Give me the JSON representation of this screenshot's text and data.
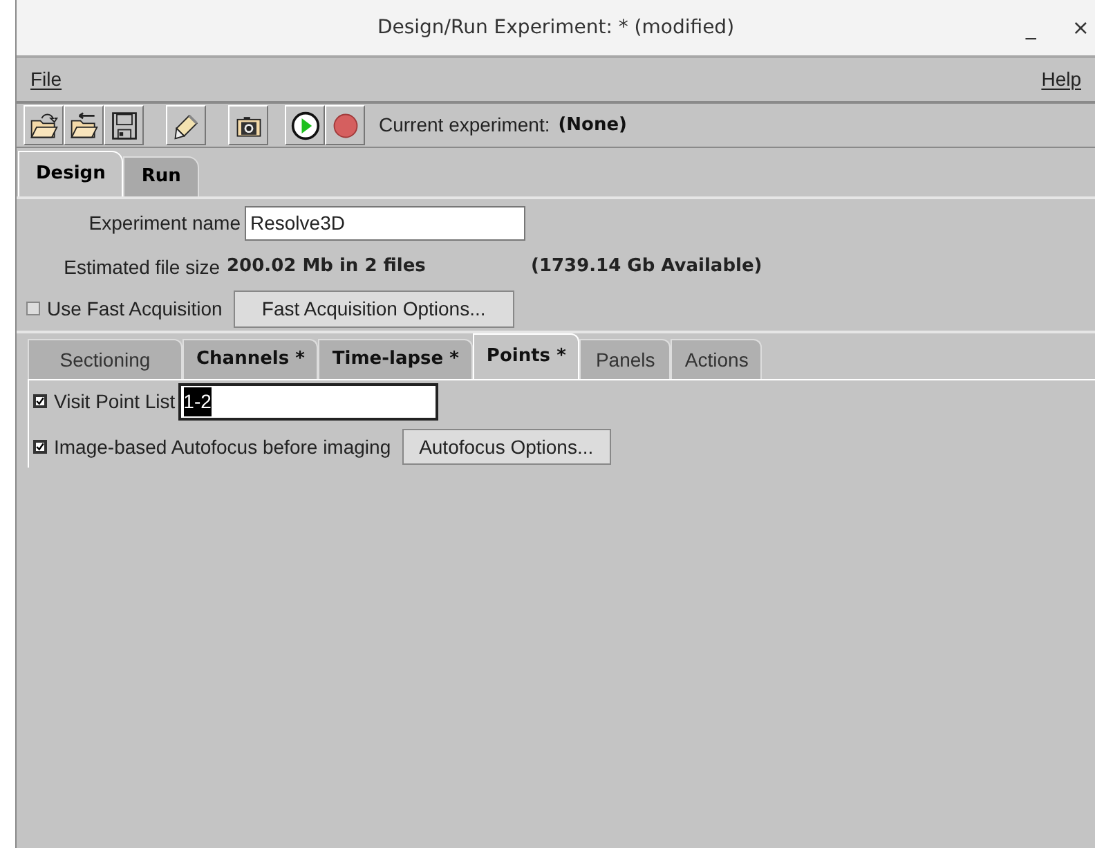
{
  "window": {
    "title": "Design/Run Experiment:  * (modified)",
    "controls": [
      "_",
      "×"
    ]
  },
  "menu": [
    {
      "label": "File"
    },
    {
      "label": "Help"
    }
  ],
  "toolbar": {
    "tools": [
      {
        "kind": "open"
      },
      {
        "kind": "revert"
      },
      {
        "kind": "save"
      },
      {
        "kind": "edit"
      },
      {
        "kind": "camera"
      },
      {
        "kind": "play"
      },
      {
        "kind": "record"
      }
    ],
    "label": "Current experiment:",
    "value": "(None)"
  },
  "tabs": [
    {
      "label": "Design",
      "selected": true
    },
    {
      "label": "Run",
      "selected": false
    }
  ],
  "experiment_name": {
    "label": "Experiment name",
    "value": "Resolve3D"
  },
  "file_size": {
    "label": "Estimated file size",
    "value": "200.02 Mb in 2 files",
    "available": "(1739.14 Gb Available)"
  },
  "fast_acquisition": {
    "label": "Use Fast Acquisition",
    "checked": false,
    "button": "Fast Acquisition Options..."
  },
  "sub_tabs": [
    {
      "label": "Sectioning",
      "modified": false,
      "selected": false
    },
    {
      "label": "Channels *",
      "modified": true,
      "selected": false
    },
    {
      "label": "Time-lapse *",
      "modified": true,
      "selected": false
    },
    {
      "label": "Points *",
      "modified": true,
      "selected": true
    },
    {
      "label": "Panels",
      "modified": false,
      "selected": false
    },
    {
      "label": "Actions",
      "modified": false,
      "selected": false
    }
  ],
  "visit_point_list": {
    "label": "Visit Point List",
    "checked": true,
    "value": "1-2",
    "highlighted": true
  },
  "autofocus": {
    "label": "Image-based Autofocus before imaging",
    "checked": true,
    "button": "Autofocus Options..."
  }
}
